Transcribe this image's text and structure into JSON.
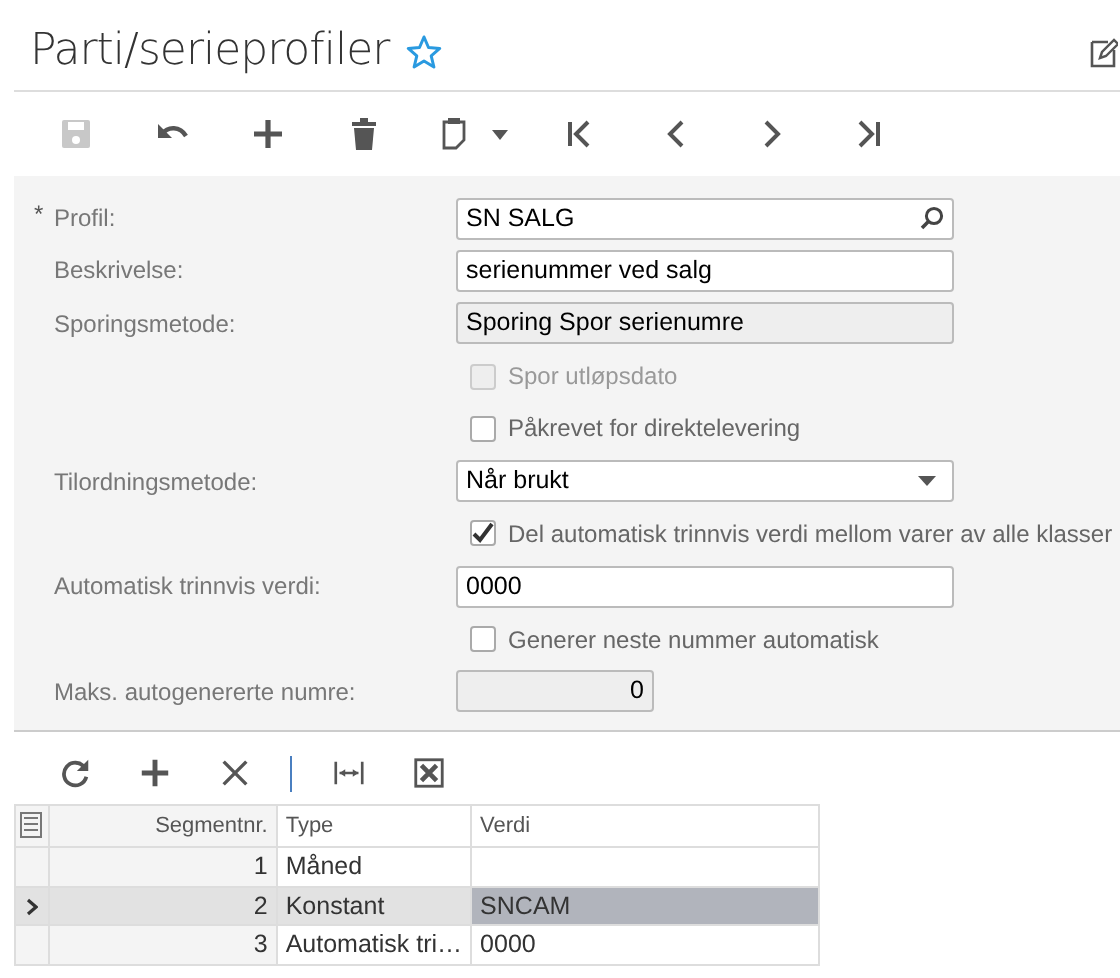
{
  "title": "Parti/serieprofiler",
  "favorite": false,
  "toolbar": [
    {
      "kind": "save",
      "disabled": true
    },
    {
      "kind": "undo",
      "disabled": false
    },
    {
      "kind": "add",
      "disabled": false
    },
    {
      "kind": "delete",
      "disabled": false
    },
    {
      "kind": "paste",
      "disabled": false
    },
    {
      "kind": "first",
      "disabled": false
    },
    {
      "kind": "prev",
      "disabled": false
    },
    {
      "kind": "next",
      "disabled": false
    },
    {
      "kind": "last",
      "disabled": false
    }
  ],
  "fields": [
    {
      "kind": "lookup",
      "label": "Profil:",
      "required_mark": "*",
      "value": "SN SALG",
      "disabled": false
    },
    {
      "kind": "text",
      "label": "Beskrivelse:",
      "value": "serienummer ved salg",
      "disabled": false
    },
    {
      "kind": "text",
      "label": "Sporingsmetode:",
      "value": "Sporing Spor serienumre",
      "disabled": true
    },
    {
      "kind": "checkbox",
      "label": "Spor utløpsdato",
      "checked": false,
      "disabled": true
    },
    {
      "kind": "checkbox",
      "label": "Påkrevet for direktelevering",
      "checked": false,
      "disabled": false
    },
    {
      "kind": "select",
      "label": "Tilordningsmetode:",
      "value": "Når brukt",
      "disabled": false
    },
    {
      "kind": "checkbox",
      "label": "Del automatisk trinnvis verdi mellom varer av alle klasser",
      "checked": true,
      "disabled": false
    },
    {
      "kind": "text",
      "label": "Automatisk trinnvis verdi:",
      "value": "0000",
      "disabled": false
    },
    {
      "kind": "checkbox",
      "label": "Generer neste nummer automatisk",
      "checked": false,
      "disabled": false
    },
    {
      "kind": "number",
      "label": "Maks. autogenererte numre:",
      "value": "0",
      "disabled": true
    }
  ],
  "grid_toolbar": [
    {
      "kind": "refresh"
    },
    {
      "kind": "add"
    },
    {
      "kind": "delete"
    },
    {
      "kind": "separator"
    },
    {
      "kind": "fit"
    },
    {
      "kind": "excel"
    }
  ],
  "table": {
    "columns": [
      "Segmentnr.",
      "Type",
      "Verdi"
    ],
    "rows": [
      {
        "segment": "1",
        "type": "Måned",
        "value": "",
        "selected": false
      },
      {
        "segment": "2",
        "type": "Konstant",
        "value": "SNCAM",
        "selected": true
      },
      {
        "segment": "3",
        "type": "Automatisk tri…",
        "value": "0000",
        "selected": false
      }
    ]
  }
}
